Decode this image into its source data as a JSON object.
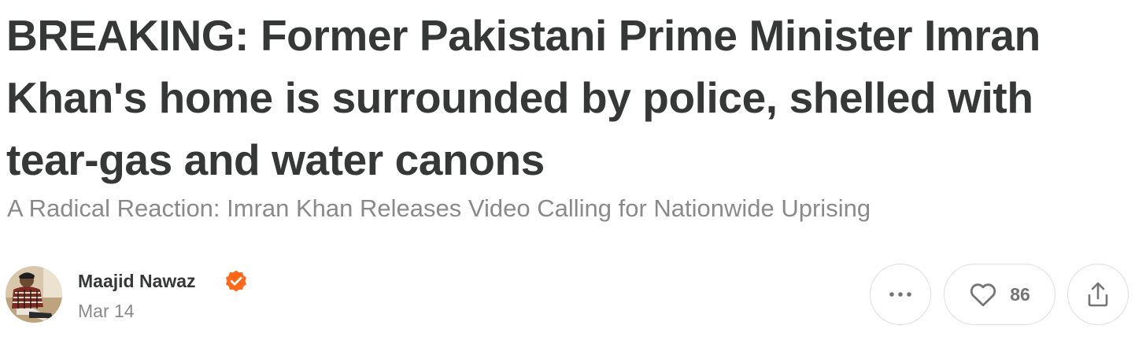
{
  "post": {
    "title": "BREAKING: Former Pakistani Prime Minister Imran Khan's home is surrounded by police, shelled with tear-gas and water canons",
    "subtitle": "A Radical Reaction: Imran Khan Releases Video Calling for Nationwide Uprising"
  },
  "author": {
    "name": "Maajid Nawaz",
    "date": "Mar 14",
    "verified_color": "#FF6719"
  },
  "actions": {
    "more_icon": "ellipsis-icon",
    "like_icon": "heart-icon",
    "like_count": "86",
    "share_icon": "share-icon"
  }
}
